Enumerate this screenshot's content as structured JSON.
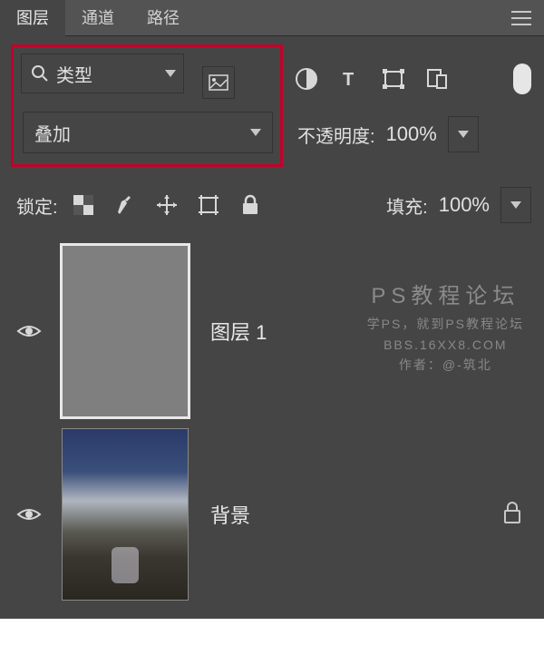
{
  "tabs": {
    "layers": "图层",
    "channels": "通道",
    "paths": "路径"
  },
  "filter": {
    "type_label": "类型"
  },
  "blend": {
    "mode": "叠加",
    "opacity_label": "不透明度:",
    "opacity_value": "100%"
  },
  "lock": {
    "label": "锁定:",
    "fill_label": "填充:",
    "fill_value": "100%"
  },
  "layers": {
    "layer1": {
      "name": "图层 1"
    },
    "background": {
      "name": "背景"
    }
  },
  "watermark": {
    "line1": "PS教程论坛",
    "line2": "学PS，就到PS教程论坛",
    "line3": "BBS.16XX8.COM",
    "line4": "作者：@-筑北"
  }
}
